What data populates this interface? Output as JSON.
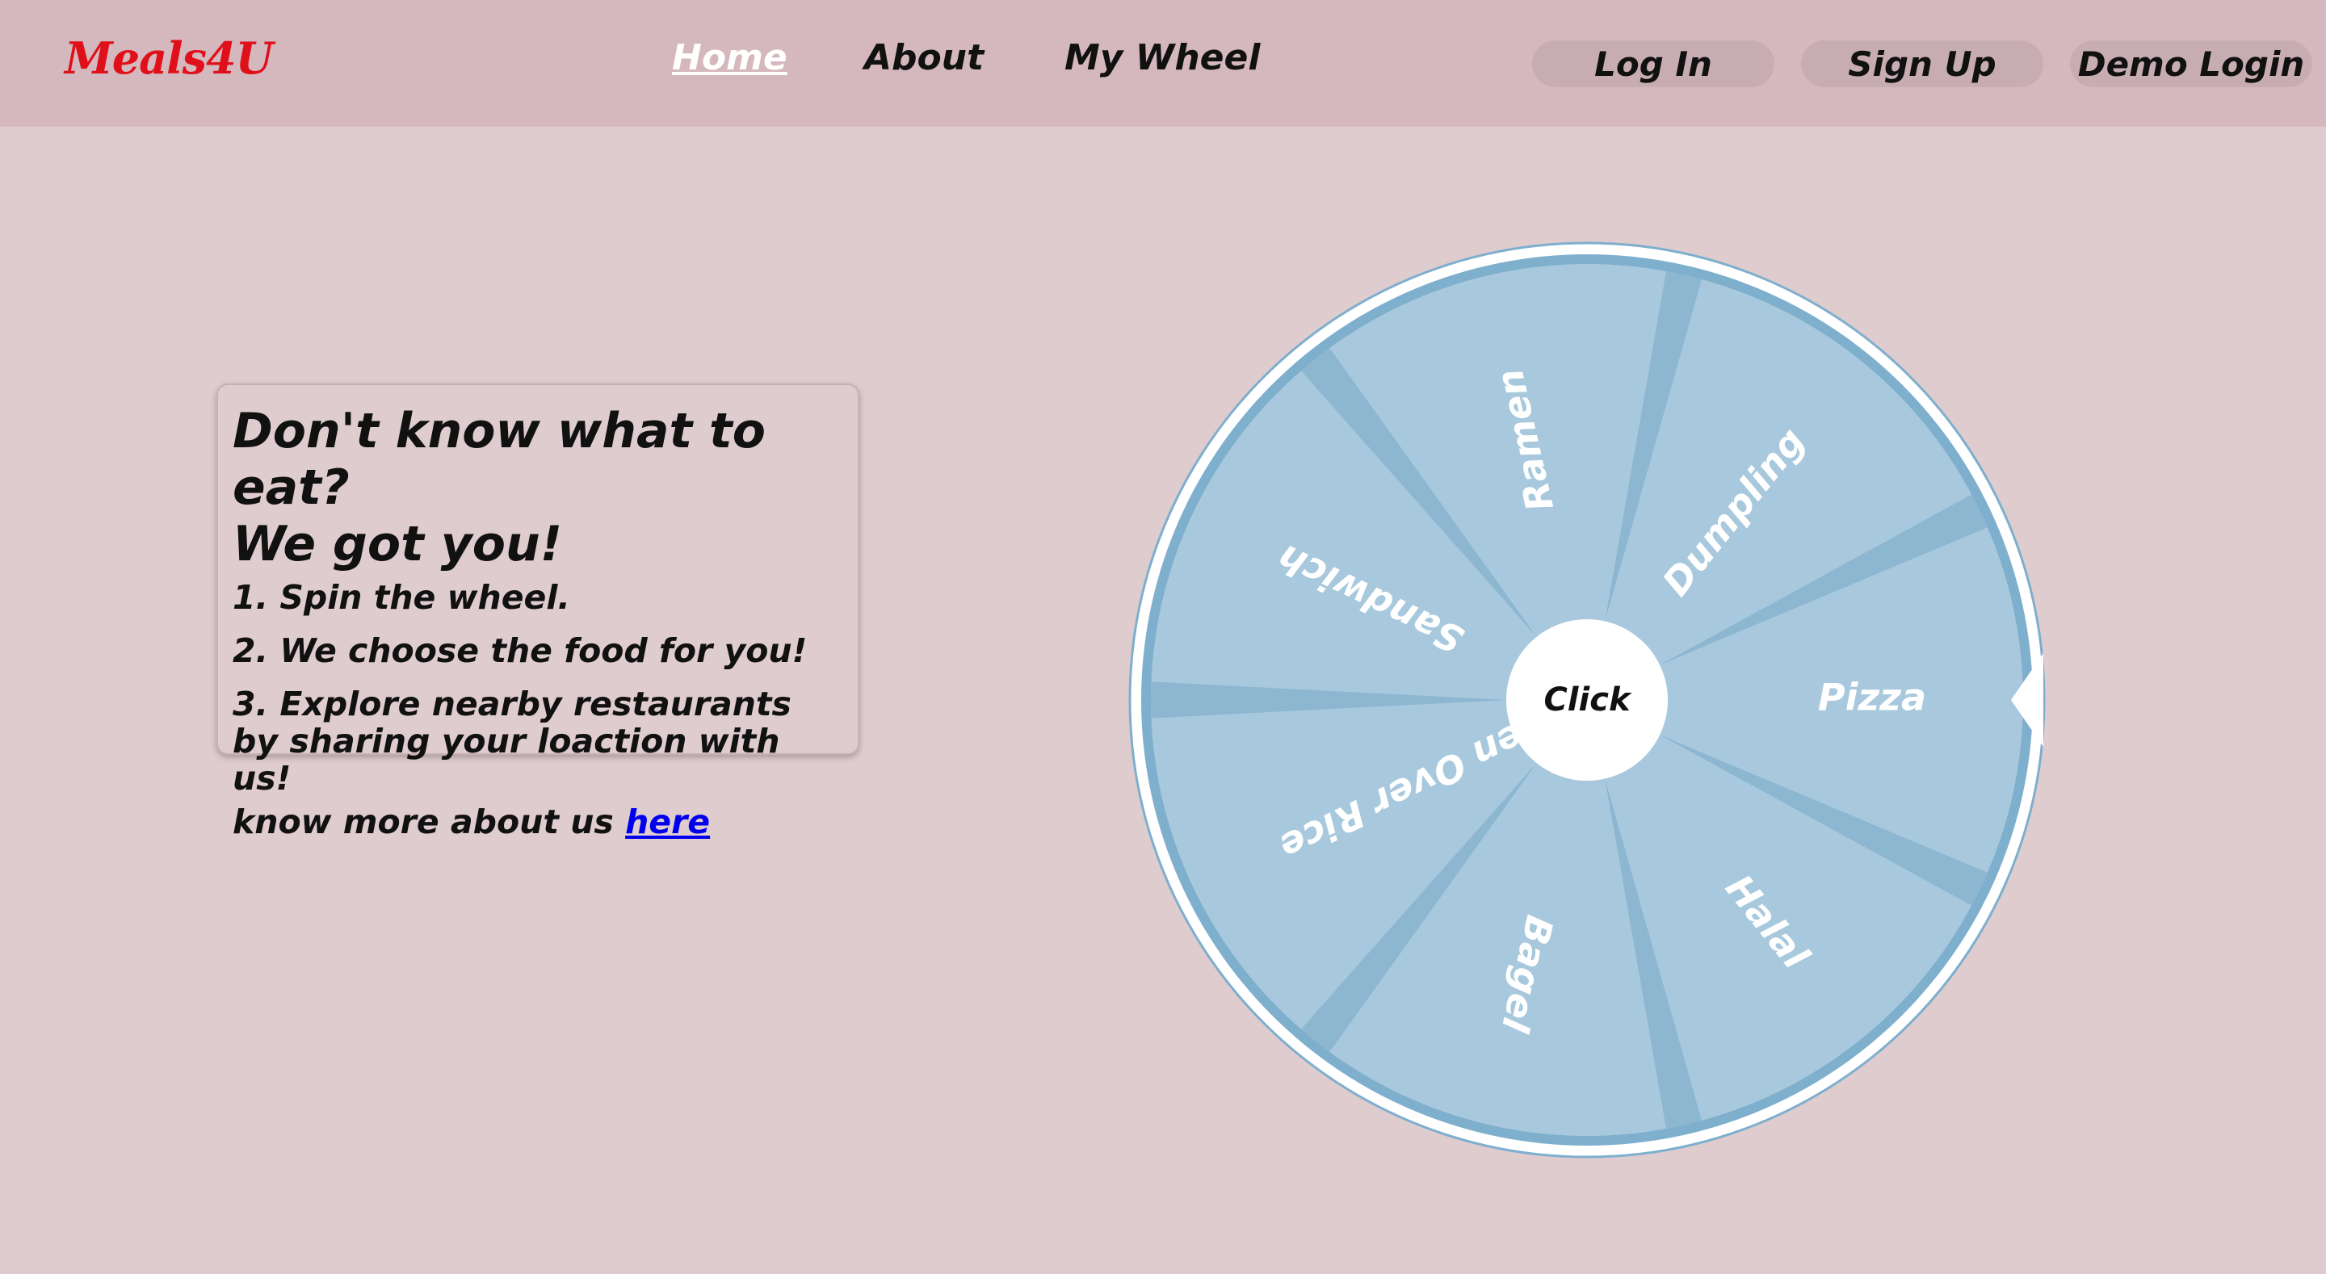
{
  "brand": {
    "logo_text": "Meals4U",
    "color": "#e0101a"
  },
  "nav": {
    "links": [
      {
        "label": "Home",
        "active": true
      },
      {
        "label": "About",
        "active": false
      },
      {
        "label": "My Wheel",
        "active": false
      }
    ],
    "buttons": [
      {
        "label": "Log In"
      },
      {
        "label": "Sign Up"
      },
      {
        "label": "Demo Login"
      }
    ]
  },
  "info": {
    "title_line1": "Don't know what to eat?",
    "title_line2": "We got you!",
    "steps": [
      "1. Spin the wheel.",
      "2. We choose the food for you!",
      "3. Explore nearby restaurants by sharing your loaction with us!"
    ],
    "more_prefix": "know more about us",
    "more_link": "here"
  },
  "wheel": {
    "center_label": "Click",
    "segments": [
      "Pizza",
      "Halal",
      "Bagel",
      "Chicken Over Rice",
      "Sandwich",
      "Ramen",
      "Dumpling"
    ],
    "colors": {
      "segment": "#a8c9dd",
      "divider": "#8db6d1",
      "rim": "#7eafcd",
      "pointer": "#ffffff"
    }
  }
}
